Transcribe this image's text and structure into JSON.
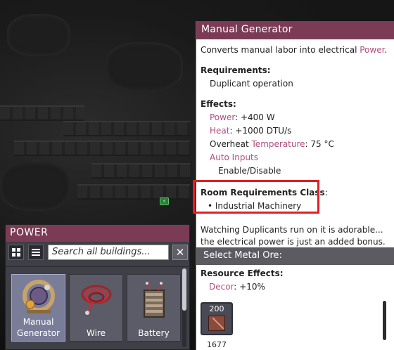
{
  "power_panel": {
    "title": "POWER",
    "grid_view_icon": "grid-icon",
    "list_view_icon": "list-icon",
    "search_placeholder": "Search all buildings...",
    "clear_label": "✕",
    "buildings": [
      {
        "label": "Manual\nGenerator",
        "icon": "manual-generator-icon",
        "selected": true
      },
      {
        "label": "Wire",
        "icon": "wire-icon",
        "selected": false
      },
      {
        "label": "Battery",
        "icon": "battery-icon",
        "selected": false
      }
    ]
  },
  "info_card": {
    "title": "Manual Generator",
    "description_prefix": "Converts manual labor into electrical ",
    "description_link": "Power",
    "description_suffix": ".",
    "requirements_head": "Requirements:",
    "requirements": [
      "Duplicant operation"
    ],
    "effects_head": "Effects:",
    "effects": [
      {
        "key": "Power",
        "sep": ": ",
        "val": "+400 W"
      },
      {
        "key": "Heat",
        "sep": ": ",
        "val": "+1000 DTU/s"
      }
    ],
    "overheat_prefix": "Overheat ",
    "overheat_key": "Temperature",
    "overheat_val": ": 75 °C",
    "auto_inputs_label": "Auto Inputs",
    "auto_inputs_value": "Enable/Disable",
    "room_head": "Room Requirements Class",
    "room_head_colon": ":",
    "room_class": "• Industrial Machinery",
    "flavor": "Watching Duplicants run on it is adorable... the electrical power is just an added bonus.",
    "ore_header": "Select Metal Ore:",
    "resource_effects_head": "Resource Effects:",
    "resource_effect_key": "Decor",
    "resource_effect_val": ": +10%",
    "ore_required": "200",
    "ore_available": "1677"
  },
  "colors": {
    "title_bar": "#7c3b55",
    "accent_pink": "#b04d82",
    "highlight_box": "#e31e24"
  }
}
